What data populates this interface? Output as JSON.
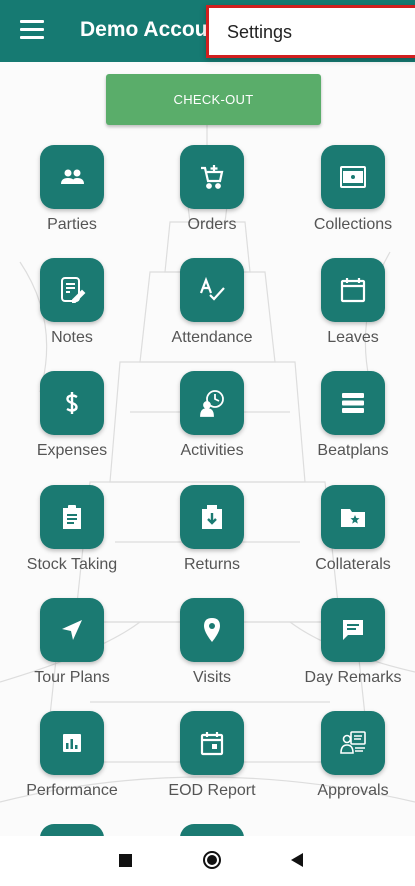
{
  "appbar": {
    "title": "Demo Account"
  },
  "overflow_menu": {
    "settings_label": "Settings"
  },
  "checkout": {
    "label": "CHECK-OUT"
  },
  "tiles": [
    {
      "label": "Parties",
      "icon": "people-icon"
    },
    {
      "label": "Orders",
      "icon": "cart-add-icon"
    },
    {
      "label": "Collections",
      "icon": "cash-icon"
    },
    {
      "label": "Notes",
      "icon": "note-edit-icon"
    },
    {
      "label": "Attendance",
      "icon": "spellcheck-icon"
    },
    {
      "label": "Leaves",
      "icon": "calendar-blank-icon"
    },
    {
      "label": "Expenses",
      "icon": "dollar-icon"
    },
    {
      "label": "Activities",
      "icon": "person-clock-icon"
    },
    {
      "label": "Beatplans",
      "icon": "stacked-list-icon"
    },
    {
      "label": "Stock Taking",
      "icon": "clipboard-list-icon"
    },
    {
      "label": "Returns",
      "icon": "box-return-icon"
    },
    {
      "label": "Collaterals",
      "icon": "folder-star-icon"
    },
    {
      "label": "Tour Plans",
      "icon": "navigation-arrow-icon"
    },
    {
      "label": "Visits",
      "icon": "location-pin-icon"
    },
    {
      "label": "Day Remarks",
      "icon": "chat-remark-icon"
    },
    {
      "label": "Performance",
      "icon": "bar-chart-icon"
    },
    {
      "label": "EOD Report",
      "icon": "calendar-day-icon"
    },
    {
      "label": "Approvals",
      "icon": "approval-person-icon"
    }
  ],
  "colors": {
    "appbar": "#167a72",
    "tile": "#1b7a72",
    "checkout": "#5aad6a",
    "highlight_border": "#d11f1f"
  }
}
